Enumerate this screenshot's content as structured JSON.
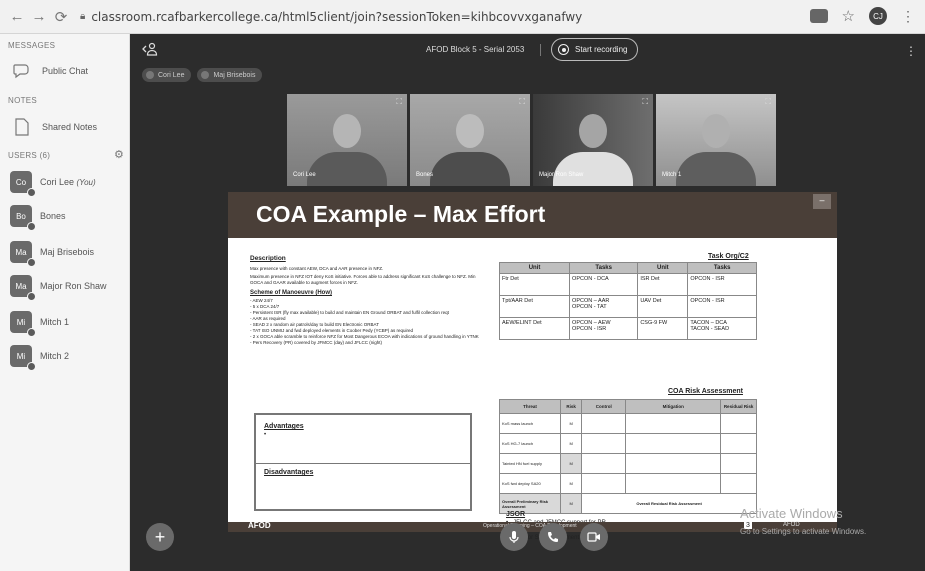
{
  "browser": {
    "url": "classroom.rcafbarkercollege.ca/html5client/join?sessionToken=kihbcovvxganafwy",
    "profile_initials": "CJ"
  },
  "sidebar": {
    "messages_title": "MESSAGES",
    "public_chat": "Public Chat",
    "notes_title": "NOTES",
    "shared_notes": "Shared Notes",
    "users_title": "USERS (6)",
    "users": [
      {
        "initials": "Co",
        "name": "Cori Lee",
        "you": "(You)"
      },
      {
        "initials": "Bo",
        "name": "Bones",
        "you": ""
      },
      {
        "initials": "Ma",
        "name": "Maj Brisebois",
        "you": ""
      },
      {
        "initials": "Ma",
        "name": "Major Ron Shaw",
        "you": ""
      },
      {
        "initials": "Mi",
        "name": "Mitch 1",
        "you": ""
      },
      {
        "initials": "Mi",
        "name": "Mitch 2",
        "you": ""
      }
    ]
  },
  "topbar": {
    "session_title": "AFOD Block 5 - Serial 2053",
    "record_label": "Start recording",
    "talkers": [
      "Cori Lee",
      "Maj Brisebois"
    ]
  },
  "videos": [
    {
      "label": "Cori Lee"
    },
    {
      "label": "Bones"
    },
    {
      "label": "Major Ron Shaw"
    },
    {
      "label": "Mitch 1"
    }
  ],
  "slide": {
    "title": "COA Example – Max Effort",
    "description_heading": "Description",
    "description_lines": [
      "Max presence with constant AEW, DCA and AAR presence in NFZ.",
      "Maximum presence in NFZ IOT deny KoS initiative. Forces able to address significant KoS challenge to NFZ. Min GOCA and GAAR available to augment forces in NFZ."
    ],
    "scheme_heading": "Scheme of Manoeuvre (How)",
    "scheme_items": [
      "AEW 24/7",
      "5 x DCA 24/7",
      "Persistent ISR (fly max available) to build and maintain EN Ground ORBAT and fulfil collection reqt",
      "AAR as required",
      "SEAD 2 x random air patrols/day to build EN Electronic ORBAT",
      "TAT ISO UNMIJ and fwd deployed elements in Coober Pedy (YCBP) as required",
      "2 x GOCA able scramble to reinforce NFZ for Most Dangerous ECOA with indications of ground handling in YTNK",
      "Pers Recovery (PR) covered by JFMCC (day) and JFLCC (night)"
    ],
    "advantages_heading": "Advantages",
    "advantages_bullet": "•",
    "disadvantages_heading": "Disadvantages",
    "task_org_heading": "Task Org/C2",
    "task_org_headers": [
      "Unit",
      "Tasks",
      "Unit",
      "Tasks"
    ],
    "task_org_rows": [
      [
        "Ftr Det",
        "OPCON - DCA",
        "ISR Det",
        "OPCON - ISR"
      ],
      [
        "Tpt/AAR Det",
        "OPCON – AAR\nOPCON - TAT",
        "UAV Det",
        "OPCON - ISR"
      ],
      [
        "AEW/ELINT Det",
        "OPCON – AEW\nOPCON - ISR",
        "CSG-9 FW",
        "TACON – DCA\nTACON - SEAD"
      ]
    ],
    "risk_heading": "COA Risk Assessment",
    "risk_headers": [
      "Threat",
      "Risk",
      "Control",
      "Mitigation",
      "Residual Risk"
    ],
    "risk_rows": [
      [
        "KoS mass launch",
        "M"
      ],
      [
        "KoS HG-7 launch",
        "M"
      ],
      [
        "Tainted HN fuel supply",
        "M"
      ],
      [
        "KoS fwd deploy SA20",
        "M"
      ]
    ],
    "overall_prelim": "Overall Preliminary Risk Assessment",
    "overall_prelim_value": "M",
    "overall_residual": "Overall Residual Risk Assessment",
    "jsor_heading": "JSOR",
    "jsor_items": [
      "JFLCC and JFMCC support for PR",
      "I&W for YTNK ground handling and movement",
      "I&W for SA20 movement"
    ],
    "footer_logo": "AFOD",
    "footer_center": "Operational Planning – COA Development",
    "footer_page": "3",
    "footer_logo2": "AFOD"
  },
  "watermark": {
    "line1": "Activate Windows",
    "line2": "Go to Settings to activate Windows."
  }
}
